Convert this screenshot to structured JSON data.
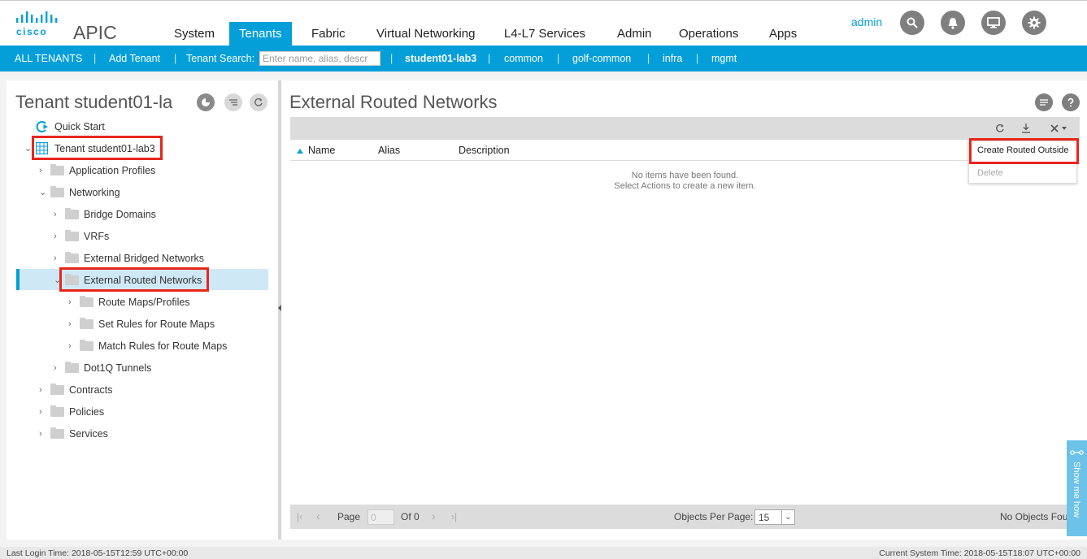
{
  "app": {
    "brand": "cisco",
    "title": "APIC",
    "accent_color": "#049fd9",
    "highlight_color": "#e8261b"
  },
  "nav": {
    "tabs": [
      {
        "label": "System"
      },
      {
        "label": "Tenants"
      },
      {
        "label": "Fabric"
      },
      {
        "label": "Virtual Networking"
      },
      {
        "label": "L4-L7 Services"
      },
      {
        "label": "Admin"
      },
      {
        "label": "Operations"
      },
      {
        "label": "Apps"
      }
    ],
    "active_tab": "Tenants",
    "user": "admin",
    "icons": [
      "search-icon",
      "bell-icon",
      "monitor-icon",
      "gear-icon"
    ]
  },
  "subnav": {
    "all_tenants": "ALL TENANTS",
    "add_tenant": "Add Tenant",
    "search_label": "Tenant Search:",
    "search_placeholder": "Enter name, alias, descr",
    "tenants": [
      "student01-lab3",
      "common",
      "golf-common",
      "infra",
      "mgmt"
    ],
    "separator": "|"
  },
  "left": {
    "title": "Tenant student01-la",
    "tree": {
      "quick_start": "Quick Start",
      "tenant": "Tenant student01-lab3",
      "application_profiles": "Application Profiles",
      "networking": "Networking",
      "bridge_domains": "Bridge Domains",
      "vrfs": "VRFs",
      "external_bridged": "External Bridged Networks",
      "external_routed": "External Routed Networks",
      "route_maps": "Route Maps/Profiles",
      "set_rules": "Set Rules for Route Maps",
      "match_rules": "Match Rules for Route Maps",
      "dot1q": "Dot1Q Tunnels",
      "contracts": "Contracts",
      "policies": "Policies",
      "services": "Services"
    }
  },
  "right": {
    "title": "External Routed Networks",
    "columns": {
      "name": "Name",
      "alias": "Alias",
      "description": "Description"
    },
    "empty_line1": "No items have been found.",
    "empty_line2": "Select Actions to create a new item.",
    "actions": {
      "create": "Create Routed Outside",
      "delete": "Delete"
    },
    "pager": {
      "page_label": "Page",
      "page_value": "0",
      "of_label": "Of 0",
      "per_page_label": "Objects Per Page:",
      "per_page_value": "15",
      "status": "No Objects Found"
    }
  },
  "footer": {
    "last_login": "Last Login Time: 2018-05-15T12:59 UTC+00:00",
    "current_time": "Current System Time: 2018-05-15T18:07 UTC+00:00"
  },
  "show_me_how": "Show me how"
}
